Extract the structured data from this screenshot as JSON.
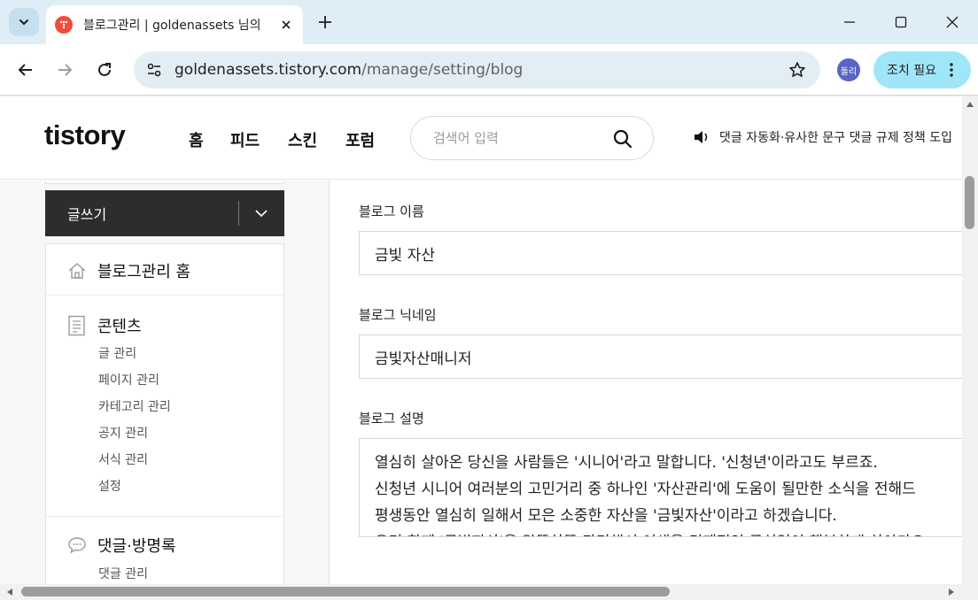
{
  "browser": {
    "tab_title": "블로그관리 | goldenassets 님의",
    "url_host": "goldenassets.tistory.com",
    "url_path": "/manage/setting/blog",
    "profile_initials": "돌리",
    "action_label": "조치 필요"
  },
  "site": {
    "logo": "tistory",
    "nav": [
      "홈",
      "피드",
      "스킨",
      "포럼"
    ],
    "search_placeholder": "검색어 입력",
    "notice": "댓글 자동화·유사한 문구 댓글 규제 정책 도입"
  },
  "sidebar": {
    "write_label": "글쓰기",
    "home_label": "블로그관리 홈",
    "contents_label": "콘텐츠",
    "contents_items": [
      "글 관리",
      "페이지 관리",
      "카테고리 관리",
      "공지 관리",
      "서식 관리",
      "설정"
    ],
    "comments_label": "댓글·방명록",
    "comments_items": [
      "댓글 관리"
    ]
  },
  "form": {
    "blog_name_label": "블로그 이름",
    "blog_name_value": "금빛 자산",
    "nickname_label": "블로그 닉네임",
    "nickname_value": "금빛자산매니저",
    "description_label": "블로그 설명",
    "description_lines": [
      "열심히 살아온 당신을 사람들은 '시니어'라고 말합니다. '신청년'이라고도 부르죠.",
      "신청년 시니어 여러분의 고민거리 중 하나인 '자산관리'에 도움이 될만한 소식을 전해드",
      "평생동안 열심히 일해서 모은 소중한 자산을 '금빛자산'이라고 하겠습니다.",
      "우리 함께 '금빛자산'을 알뜰살뜰 관리해서 여생을 경제적인 근심없이 행복하게 살아가요"
    ]
  },
  "colors": {
    "browser_frame": "#dfeef6",
    "write_button": "#2d2d2d",
    "action_pill": "#9fe6f9",
    "favicon": "#f24c3d",
    "profile": "#5b63c7"
  },
  "icons": [
    "tab-search-icon",
    "tistory-favicon-icon",
    "close-icon",
    "plus-icon",
    "minimize-icon",
    "maximize-icon",
    "back-icon",
    "forward-icon",
    "reload-icon",
    "site-info-icon",
    "star-icon",
    "kebab-icon",
    "search-icon",
    "speaker-icon",
    "chevron-down-icon",
    "home-icon",
    "document-icon",
    "comment-icon"
  ]
}
